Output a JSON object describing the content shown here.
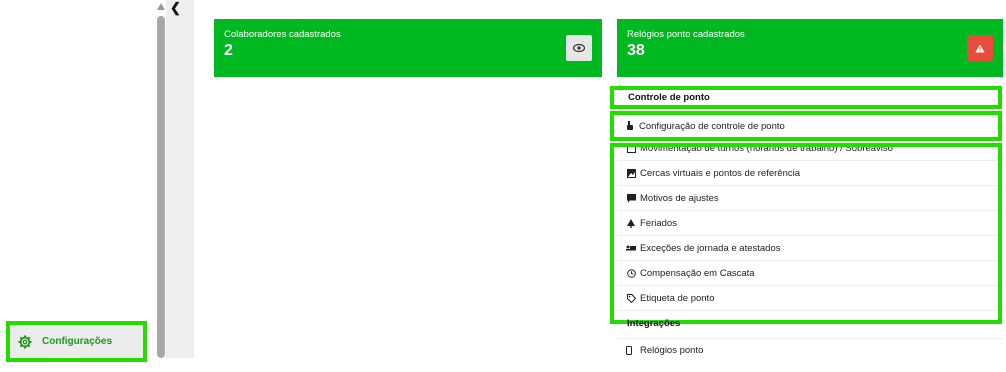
{
  "sidebar": {
    "config_label": "Configurações"
  },
  "cards": [
    {
      "title": "Colaboradores cadastrados",
      "value": "2",
      "action_icon": "eye-icon"
    },
    {
      "title": "Relógios ponto cadastrados",
      "value": "38",
      "action_icon": "warning-icon"
    }
  ],
  "menu": {
    "section_title": "Controle de ponto",
    "selected_item": {
      "label": "Configuração de controle de ponto",
      "icon": "hand-pointer-icon"
    },
    "items": [
      {
        "label": "Movimentação de turnos (horários de trabalho) / Sobreaviso",
        "icon": "calendar-icon"
      },
      {
        "label": "Cercas virtuais e pontos de referência",
        "icon": "map-icon"
      },
      {
        "label": "Motivos de ajustes",
        "icon": "comment-icon"
      },
      {
        "label": "Feriados",
        "icon": "tree-icon"
      },
      {
        "label": "Exceções de jornada e atestados",
        "icon": "bed-icon"
      },
      {
        "label": "Compensação em Cascata",
        "icon": "clock-icon"
      },
      {
        "label": "Etiqueta de ponto",
        "icon": "tag-icon"
      }
    ],
    "integrations_title": "Integrações",
    "integrations_items": [
      {
        "label": "Relógios ponto",
        "icon": "device-icon"
      }
    ]
  },
  "colors": {
    "card_green": "#00b81f",
    "highlight_green": "#22dd00",
    "warning_red": "#e84c3d"
  }
}
